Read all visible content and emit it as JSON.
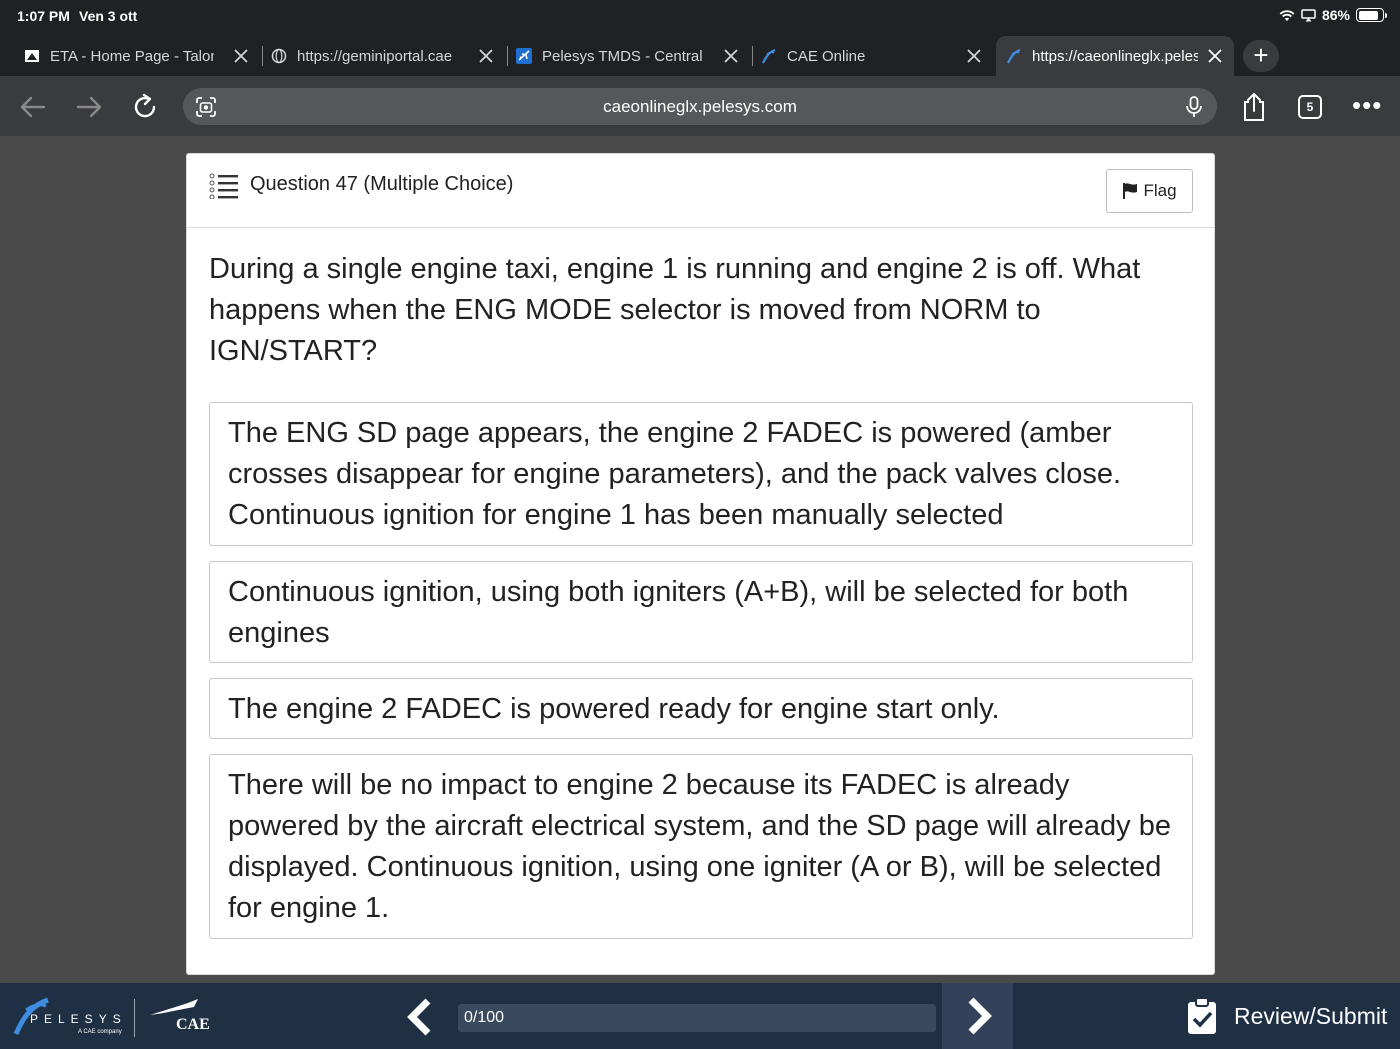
{
  "status_bar": {
    "time": "1:07 PM",
    "date": "Ven 3 ott",
    "battery": "86%",
    "battery_level": 0.86,
    "icons": [
      "wifi-icon",
      "screen-mirror-icon",
      "battery-icon"
    ]
  },
  "tabs": [
    {
      "title": "ETA - Home Page - Talon",
      "icon": "home-page-icon",
      "active": false
    },
    {
      "title": "https://geminiportal.cae",
      "icon": "globe-icon",
      "active": false
    },
    {
      "title": "Pelesys TMDS - Central",
      "icon": "airplane-icon",
      "active": false
    },
    {
      "title": "CAE Online",
      "icon": "pelesys-icon",
      "active": false
    },
    {
      "title": "https://caeonlineglx.pelesys.com",
      "icon": "pelesys-icon",
      "active": true
    }
  ],
  "new_tab_label": "+",
  "toolbar": {
    "url": "caeonlineglx.pelesys.com",
    "tab_count": "5",
    "more_label": "•••"
  },
  "question": {
    "title": "Question 47 (Multiple Choice)",
    "flag_label": "Flag",
    "text": "During a single engine taxi, engine 1 is running and engine 2 is off. What happens when the ENG MODE selector is moved from NORM to IGN/START?",
    "options": [
      "The ENG SD page appears, the engine 2 FADEC is powered (amber crosses disappear for engine parameters), and the pack valves close. Continuous ignition for engine 1 has been manually selected",
      "Continuous ignition, using both igniters (A+B), will be selected for both engines",
      "The engine 2 FADEC is powered ready for engine start only.",
      "There will be no impact to engine 2 because its FADEC is already powered by the aircraft electrical system, and the SD page will already be displayed. Continuous ignition, using one igniter (A or B), will be selected for engine 1."
    ]
  },
  "footer": {
    "pelesys_logo": "PELESYS",
    "pelesys_tagline": "A CAE company",
    "cae_logo": "CAE",
    "progress_label": "0/100",
    "progress_fraction": 0,
    "review_label": "Review/Submit"
  },
  "colors": {
    "footer_bg": "#1f2f44",
    "page_bg": "#4a4a4a",
    "chrome_bg": "#202124"
  }
}
